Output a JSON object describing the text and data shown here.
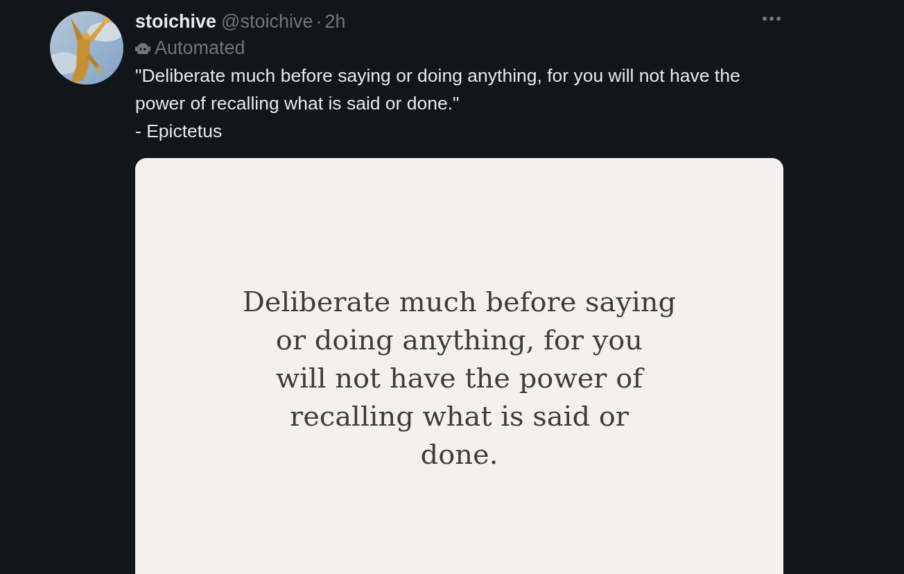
{
  "tweet": {
    "display_name": "stoichive",
    "handle": "@stoichive",
    "separator": "·",
    "time": "2h",
    "label": "Automated",
    "text": "\"Deliberate much before saying or doing anything, for you will not have the power of recalling what is said or done.\"\n- Epictetus",
    "media": {
      "kind": "quote-card",
      "text": "Deliberate much before saying\nor doing anything, for you\nwill not have the power of\nrecalling what is said or\ndone."
    }
  }
}
